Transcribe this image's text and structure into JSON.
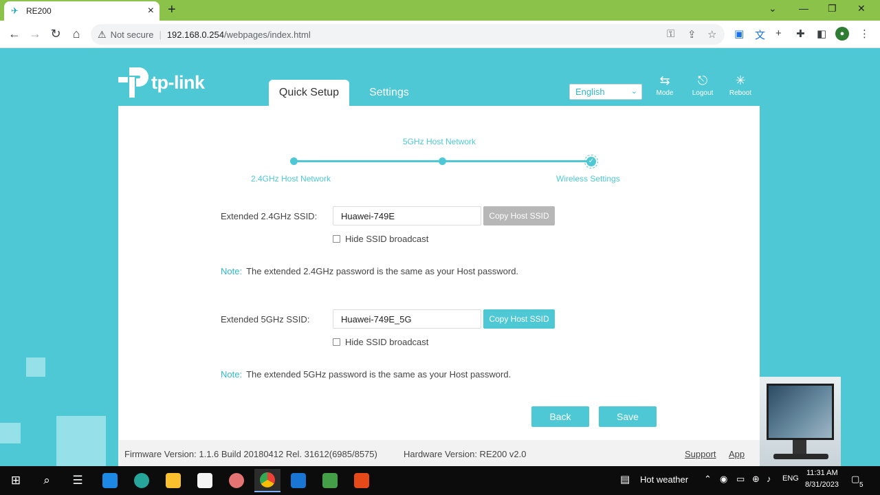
{
  "browser": {
    "tab_title": "RE200",
    "tab_favicon": "tplink-favicon-icon",
    "new_tab": "+",
    "security_label": "Not secure",
    "url_host": "192.168.0.254",
    "url_path": "/webpages/index.html",
    "window_controls": [
      "⌄",
      "—",
      "❐",
      "✕"
    ]
  },
  "header": {
    "logo_text": "tp-link",
    "tabs": [
      {
        "label": "Quick Setup",
        "active": true
      },
      {
        "label": "Settings",
        "active": false
      }
    ],
    "language": "English",
    "actions": [
      {
        "label": "Mode",
        "icon": "mode-icon"
      },
      {
        "label": "Logout",
        "icon": "logout-icon"
      },
      {
        "label": "Reboot",
        "icon": "reboot-icon"
      }
    ]
  },
  "stepper": {
    "steps": [
      {
        "label": "2.4GHz Host Network"
      },
      {
        "label": "5GHz Host Network"
      },
      {
        "label": "Wireless Settings"
      }
    ]
  },
  "form": {
    "ssid24": {
      "label": "Extended 2.4GHz SSID:",
      "value": "Huawei-749E",
      "copy_label": "Copy Host SSID",
      "hide_label": "Hide SSID broadcast",
      "hide_checked": false
    },
    "note24": {
      "tag": "Note:",
      "text": "The extended 2.4GHz password is the same as your Host password."
    },
    "ssid5": {
      "label": "Extended 5GHz SSID:",
      "value": "Huawei-749E_5G",
      "copy_label": "Copy Host SSID",
      "hide_label": "Hide SSID broadcast",
      "hide_checked": false
    },
    "note5": {
      "tag": "Note:",
      "text": "The extended 5GHz password is the same as your Host password."
    },
    "back_label": "Back",
    "save_label": "Save"
  },
  "footer": {
    "firmware": "Firmware Version: 1.1.6 Build 20180412 Rel. 31612(6985/8575)",
    "hardware": "Hardware Version: RE200 v2.0",
    "support": "Support",
    "app": "App"
  },
  "taskbar": {
    "weather": "Hot weather",
    "lang": "ENG",
    "time": "11:31 AM",
    "date": "8/31/2023",
    "notifications": "5"
  },
  "colors": {
    "accent": "#4ec8d4",
    "chrome_tabbar": "#8bc34a",
    "disabled_button": "#b7b7b7"
  }
}
